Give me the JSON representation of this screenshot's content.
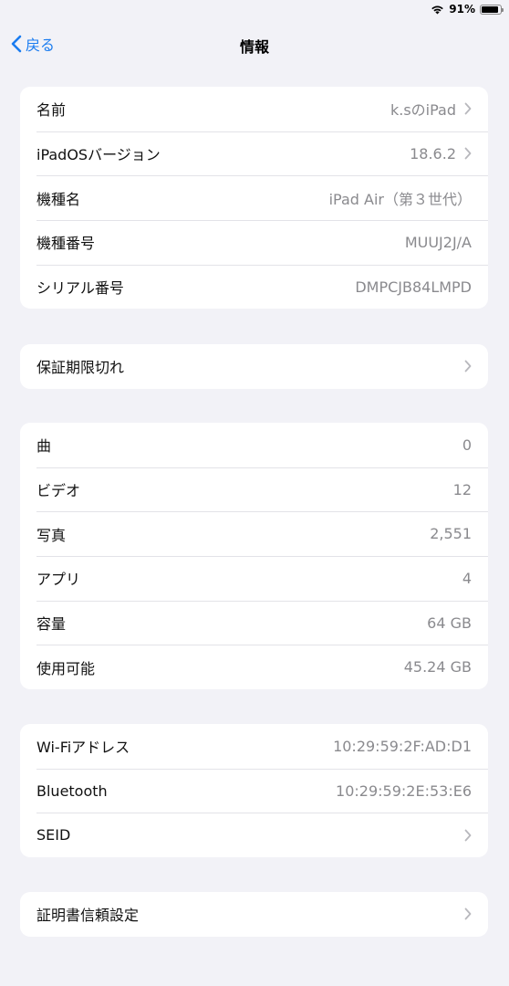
{
  "status": {
    "battery": "91%",
    "battery_level": 0.91
  },
  "nav": {
    "back_label": "戻る",
    "title": "情報"
  },
  "group1": [
    {
      "label": "名前",
      "value": "k.sのiPad"
    },
    {
      "label": "iPadOSバージョン",
      "value": "18.6.2"
    },
    {
      "label": "機種名",
      "value": "iPad Air（第３世代）"
    },
    {
      "label": "機種番号",
      "value": "MUUJ2J/A"
    },
    {
      "label": "シリアル番号",
      "value": "DMPCJB84LMPD"
    }
  ],
  "group2": [
    {
      "label": "保証期限切れ"
    }
  ],
  "group3": [
    {
      "label": "曲",
      "value": "0"
    },
    {
      "label": "ビデオ",
      "value": "12"
    },
    {
      "label": "写真",
      "value": "2,551"
    },
    {
      "label": "アプリ",
      "value": "4"
    },
    {
      "label": "容量",
      "value": "64 GB"
    },
    {
      "label": "使用可能",
      "value": "45.24 GB"
    }
  ],
  "group4": [
    {
      "label": "Wi-Fiアドレス",
      "value": "10:29:59:2F:AD:D1"
    },
    {
      "label": "Bluetooth",
      "value": "10:29:59:2E:53:E6"
    },
    {
      "label": "SEID"
    }
  ],
  "group5": [
    {
      "label": "証明書信頼設定"
    }
  ]
}
